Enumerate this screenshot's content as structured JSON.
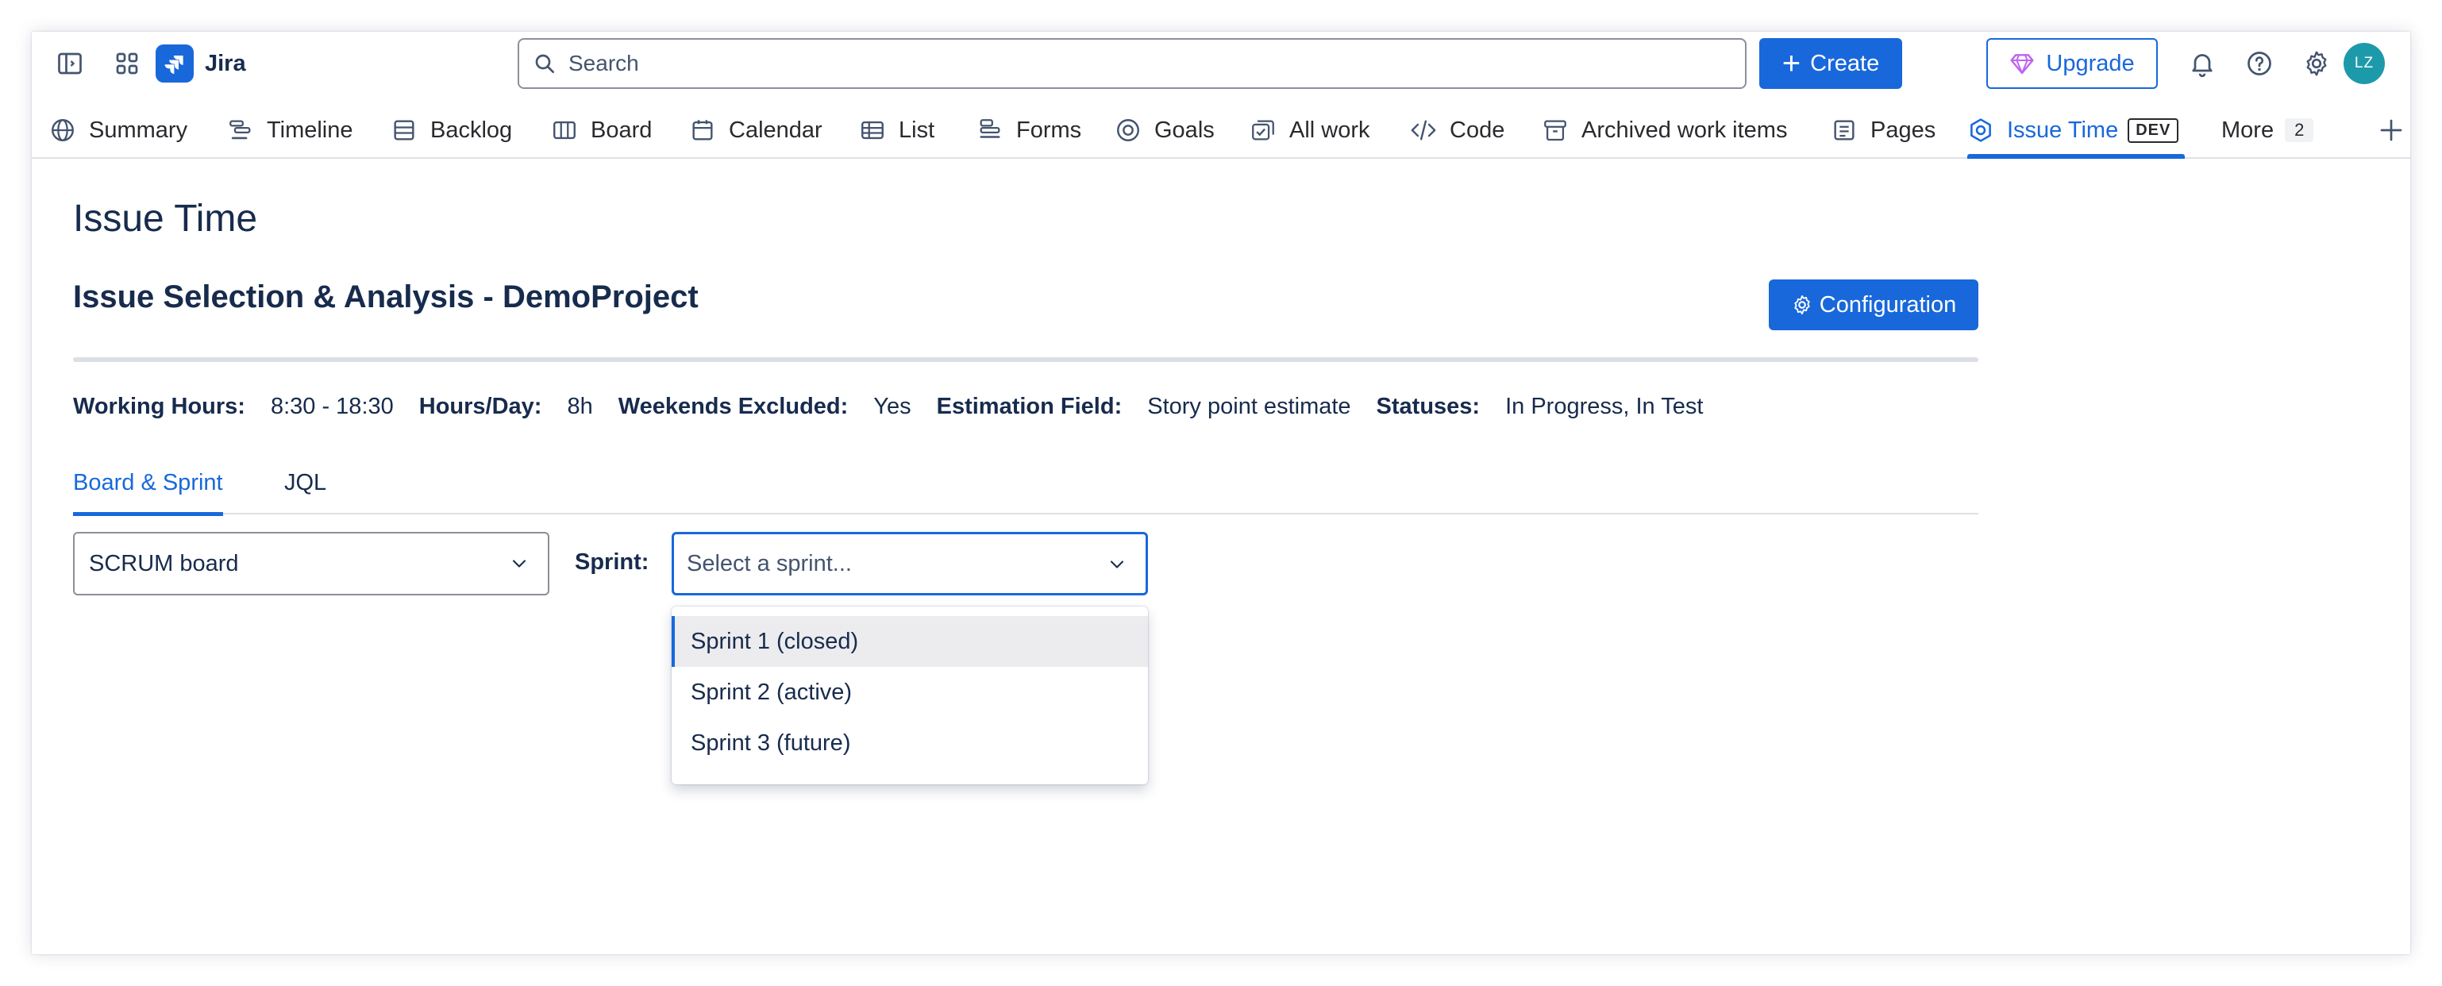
{
  "topbar": {
    "app_name": "Jira",
    "search_placeholder": "Search",
    "create_label": "Create",
    "upgrade_label": "Upgrade",
    "avatar_initials": "LZ",
    "colors": {
      "brand": "#1868db",
      "avatar": "#1d9aaa",
      "upgrade_gem": "#bf63f3"
    }
  },
  "nav": {
    "tabs": [
      {
        "label": "Summary",
        "icon": "globe-icon"
      },
      {
        "label": "Timeline",
        "icon": "timeline-icon"
      },
      {
        "label": "Backlog",
        "icon": "backlog-icon"
      },
      {
        "label": "Board",
        "icon": "board-icon"
      },
      {
        "label": "Calendar",
        "icon": "calendar-icon"
      },
      {
        "label": "List",
        "icon": "list-icon"
      },
      {
        "label": "Forms",
        "icon": "forms-icon"
      },
      {
        "label": "Goals",
        "icon": "goals-icon"
      },
      {
        "label": "All work",
        "icon": "all-work-icon"
      },
      {
        "label": "Code",
        "icon": "code-icon"
      },
      {
        "label": "Archived work items",
        "icon": "archive-icon"
      },
      {
        "label": "Pages",
        "icon": "pages-icon"
      },
      {
        "label": "Issue Time",
        "icon": "app-icon",
        "badge": "DEV",
        "active": true
      }
    ],
    "more_label": "More",
    "more_count": "2"
  },
  "main": {
    "page_title": "Issue Time",
    "section_title": "Issue Selection & Analysis - DemoProject",
    "config_button": "Configuration",
    "meta": [
      {
        "label": "Working Hours:",
        "value": "8:30 - 18:30"
      },
      {
        "label": "Hours/Day:",
        "value": "8h"
      },
      {
        "label": "Weekends Excluded:",
        "value": "Yes"
      },
      {
        "label": "Estimation Field:",
        "value": "Story point estimate"
      },
      {
        "label": "Statuses:",
        "value": "In Progress, In Test"
      }
    ],
    "subtabs": [
      {
        "label": "Board & Sprint",
        "active": true
      },
      {
        "label": "JQL",
        "active": false
      }
    ],
    "board_select_value": "SCRUM board",
    "sprint_label": "Sprint:",
    "sprint_placeholder": "Select a sprint...",
    "sprint_options": [
      "Sprint 1 (closed)",
      "Sprint 2 (active)",
      "Sprint 3 (future)"
    ]
  }
}
